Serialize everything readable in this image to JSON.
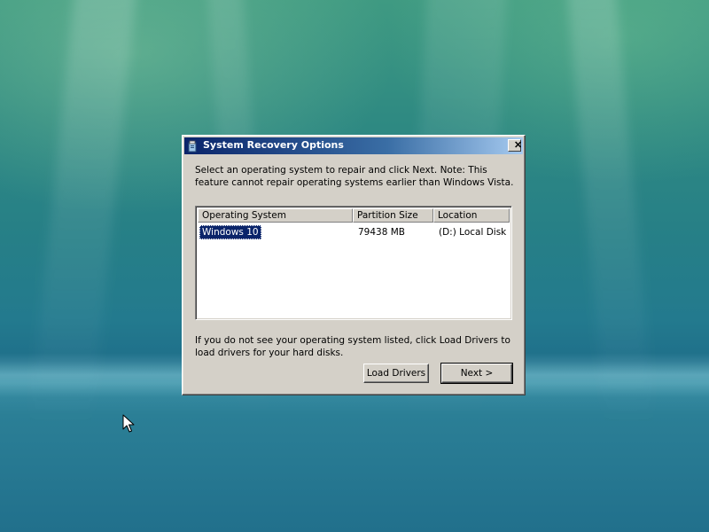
{
  "dialog": {
    "title": "System Recovery Options",
    "close_label": "✕",
    "intro": "Select an operating system to repair and click Next. Note: This feature cannot repair operating systems earlier than Windows Vista.",
    "columns": [
      "Operating System",
      "Partition Size",
      "Location"
    ],
    "rows": [
      {
        "os": "Windows 10",
        "size": "79438 MB",
        "location": "(D:) Local Disk",
        "selected": true
      }
    ],
    "hint": "If you do not see your operating system listed, click Load Drivers to load drivers for your hard disks.",
    "load_drivers_label": "Load Drivers",
    "next_label": "Next >"
  },
  "icons": {
    "title_icon": "recovery-icon",
    "close_icon": "close-icon",
    "cursor": "mouse-pointer-icon"
  },
  "colors": {
    "titlebar_start": "#0a246a",
    "titlebar_end": "#a6caf0",
    "dialog_face": "#d4d0c8",
    "selection": "#0a246a"
  }
}
